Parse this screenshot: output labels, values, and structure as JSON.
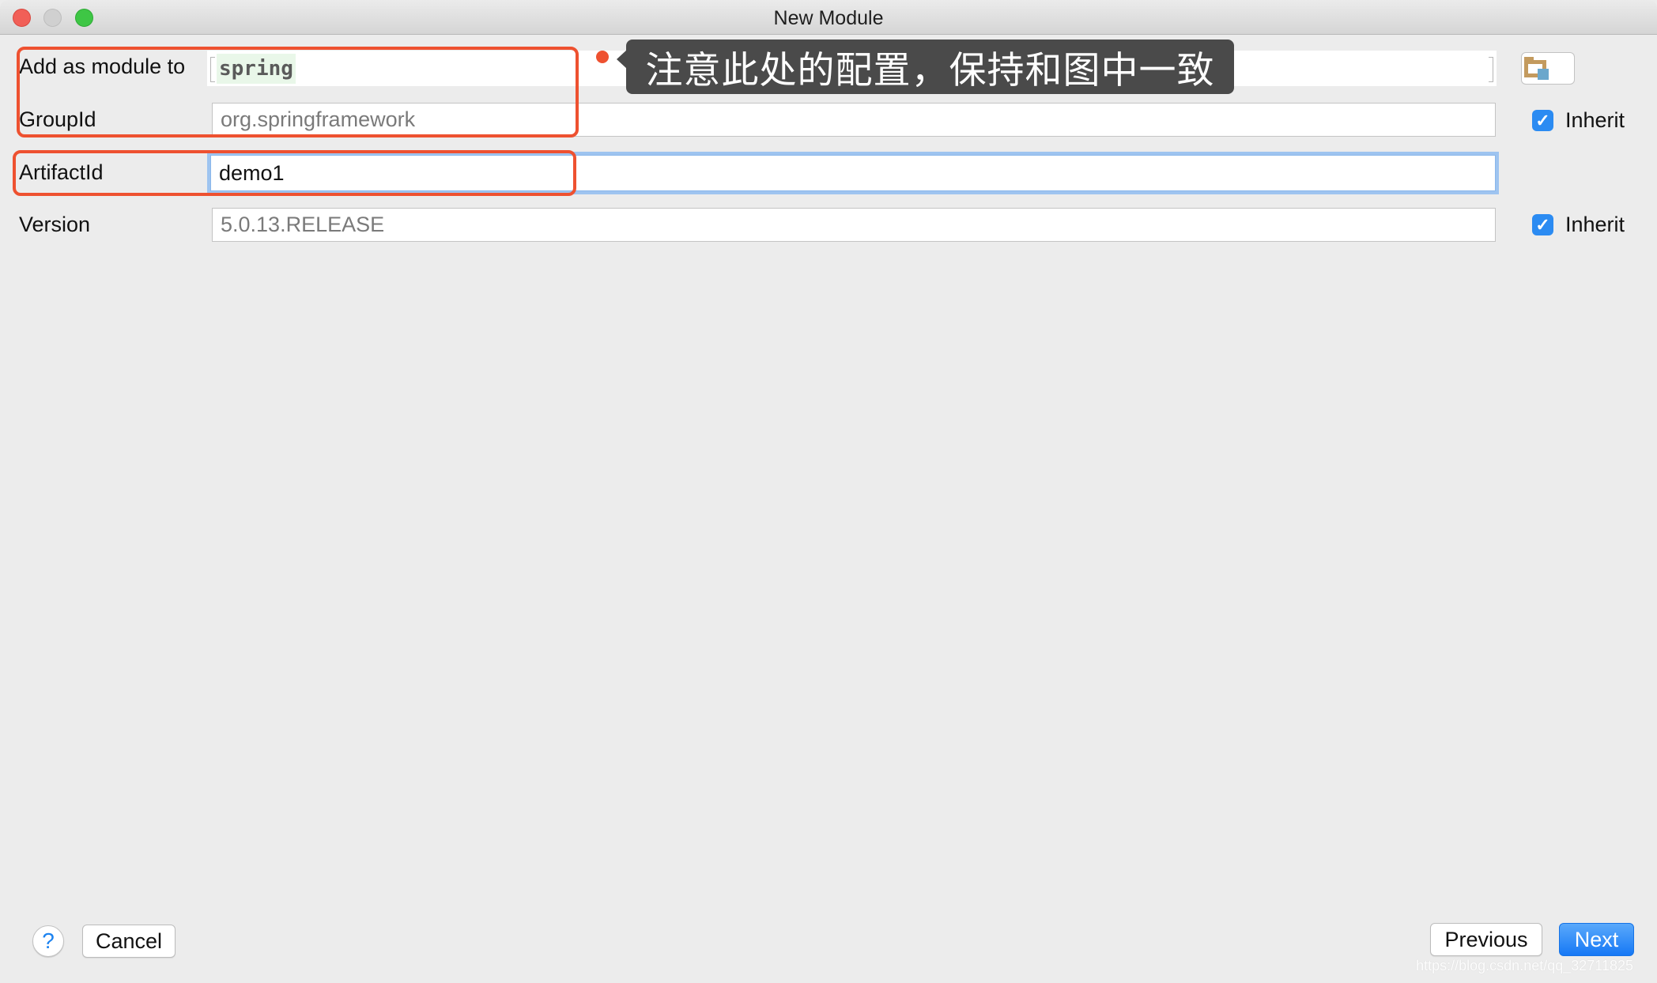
{
  "window": {
    "title": "New Module",
    "traffic_lights": [
      "close",
      "minimize",
      "zoom"
    ]
  },
  "form": {
    "add_as_module_to": {
      "label": "Add as module to",
      "value": "spring",
      "browse_icon": "folder-icon"
    },
    "group_id": {
      "label": "GroupId",
      "value": "org.springframework",
      "inherit_label": "Inherit",
      "inherit_checked": true
    },
    "artifact_id": {
      "label": "ArtifactId",
      "value": "demo1"
    },
    "version": {
      "label": "Version",
      "value": "5.0.13.RELEASE",
      "inherit_label": "Inherit",
      "inherit_checked": true
    }
  },
  "annotation": {
    "text": "注意此处的配置，保持和图中一致",
    "highlight_color": "#ee5130"
  },
  "footer": {
    "help_label": "?",
    "cancel_label": "Cancel",
    "previous_label": "Previous",
    "next_label": "Next"
  },
  "checkmark": "✓",
  "watermark": "https://blog.csdn.net/qq_32711825",
  "colors": {
    "accent": "#1d83f0",
    "focus_ring": "#9ec4f0",
    "annotation_bg": "#4a4a4a"
  }
}
